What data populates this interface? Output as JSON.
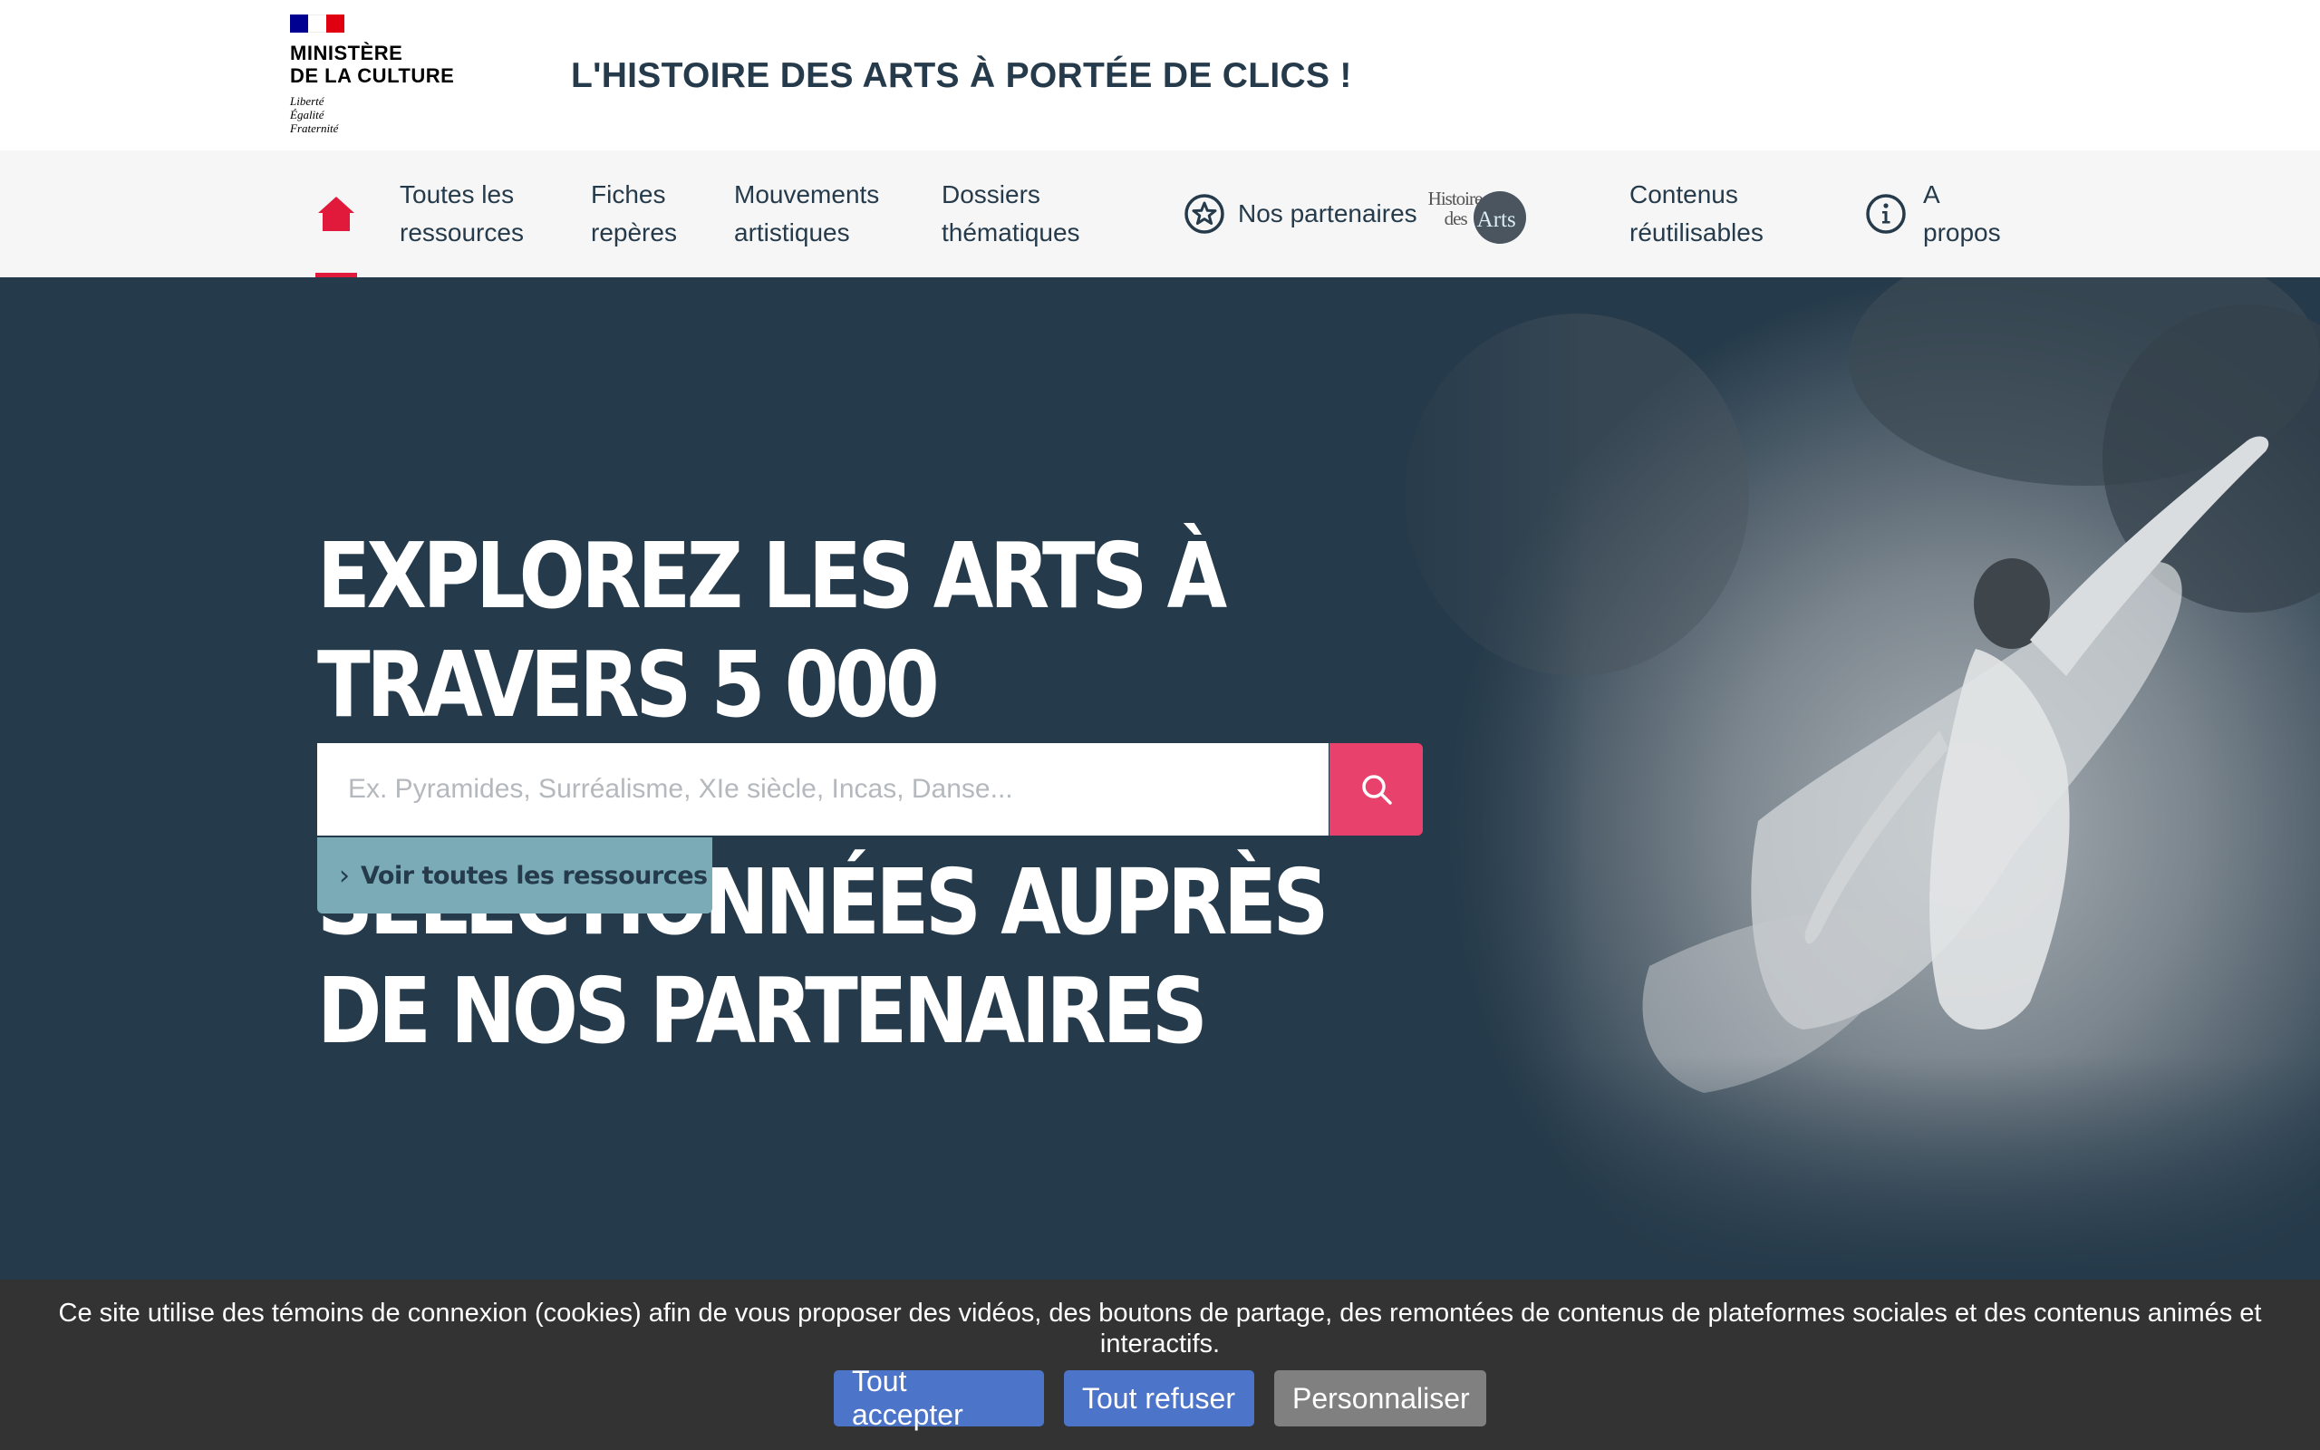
{
  "header": {
    "ministry_line1": "MINISTÈRE",
    "ministry_line2": "DE LA CULTURE",
    "motto_1": "Liberté",
    "motto_2": "Égalité",
    "motto_3": "Fraternité",
    "site_title": "L'HISTOIRE DES ARTS À PORTÉE DE CLICS !"
  },
  "nav": {
    "home_icon": "home-icon",
    "items": [
      {
        "label": "Toutes les\nressources"
      },
      {
        "label": "Fiches\nrepères"
      },
      {
        "label": "Mouvements\nartistiques"
      },
      {
        "label": "Dossiers\nthématiques"
      },
      {
        "label": "Nos partenaires",
        "icon": "star-circle-icon"
      },
      {
        "label": "Contenus\nréutilisables"
      },
      {
        "label": "A\npropos",
        "icon": "info-circle-icon"
      }
    ],
    "partner_logo": {
      "line1": "Histoire",
      "line2": "des",
      "line3": "Arts"
    },
    "active_color": "#e1193a"
  },
  "hero": {
    "title": "EXPLOREZ LES ARTS À TRAVERS 5 000 RESSOURCES SÉLECTIONNÉES AUPRÈS DE NOS PARTENAIRES",
    "search_placeholder": "Ex. Pyramides, Surréalisme, XIe siècle, Incas, Danse...",
    "search_icon": "search-icon",
    "see_all_label": "Voir toutes les ressources",
    "background_color": "#253a4a",
    "accent_color": "#e8416b"
  },
  "cookie": {
    "text": "Ce site utilise des témoins de connexion (cookies) afin de vous proposer des vidéos, des boutons de partage, des remontées de contenus de plateformes sociales et des contenus animés et interactifs.",
    "accept_label": "Tout accepter",
    "refuse_label": "Tout refuser",
    "customize_label": "Personnaliser"
  }
}
